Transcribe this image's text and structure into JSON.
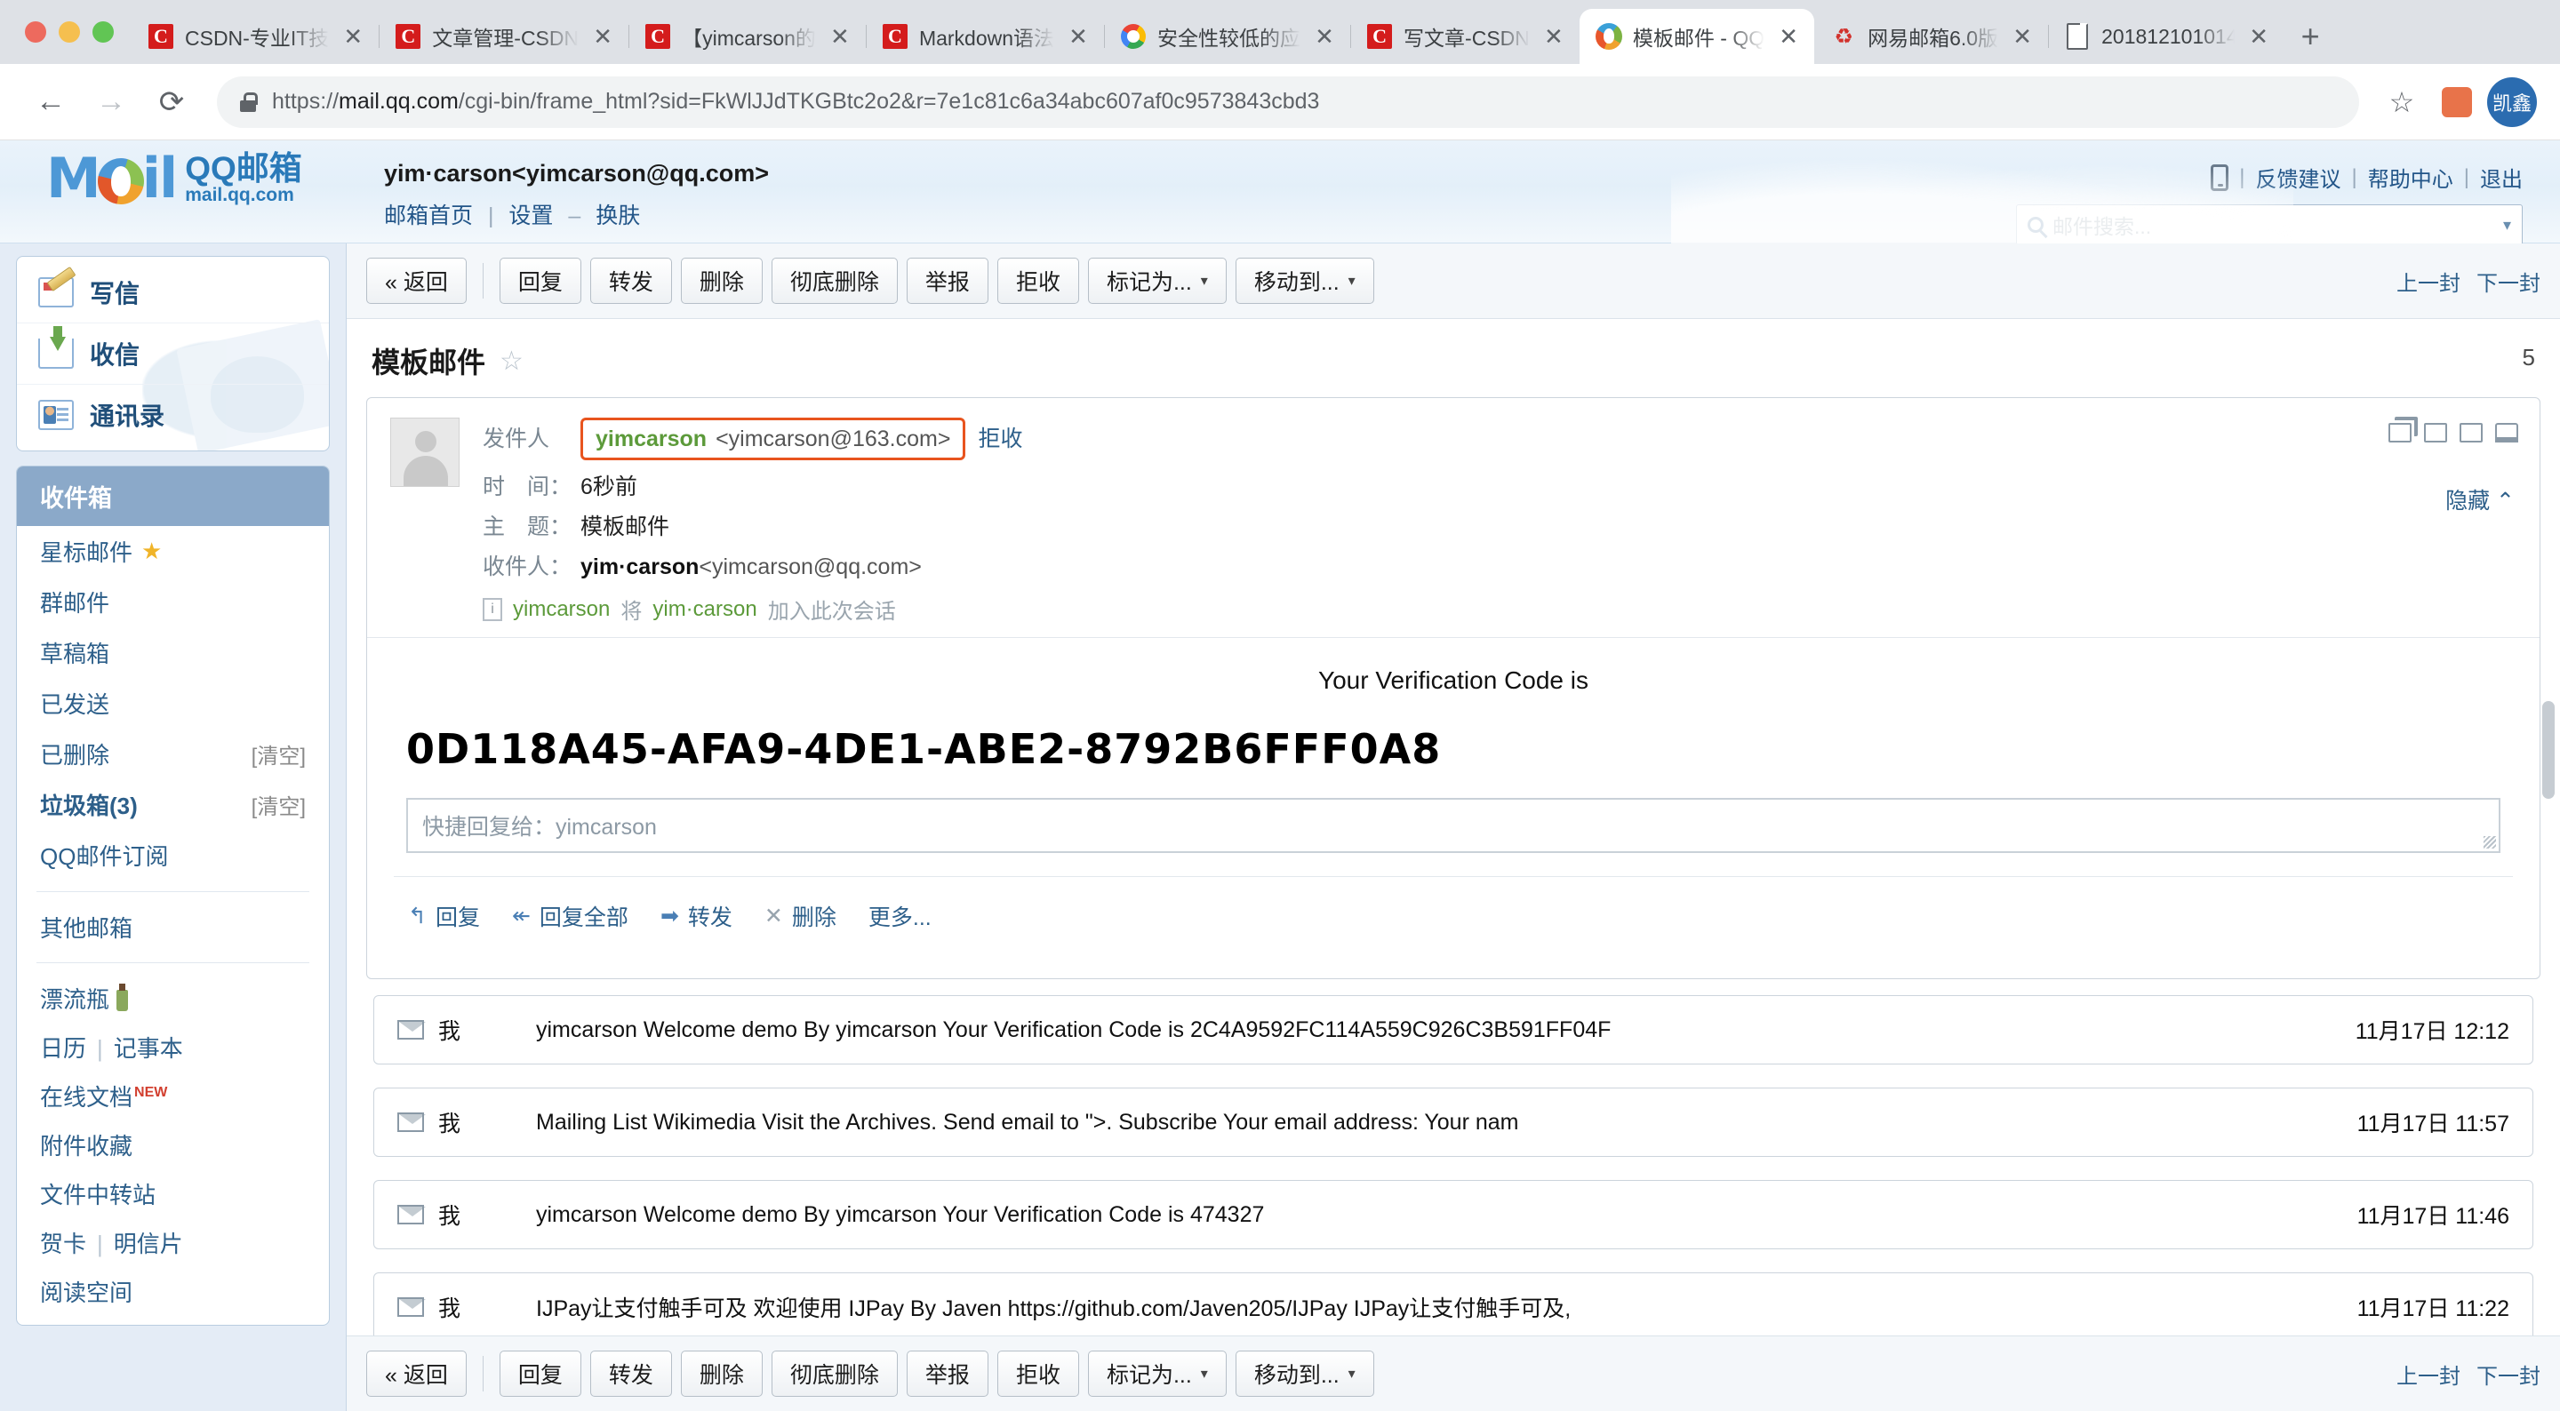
{
  "browser": {
    "tabs": [
      {
        "title": "CSDN-专业IT技",
        "favicon": "csdn-icon",
        "active": false
      },
      {
        "title": "文章管理-CSDN",
        "favicon": "csdn-icon",
        "active": false
      },
      {
        "title": "【yimcarson的",
        "favicon": "csdn-icon",
        "active": false
      },
      {
        "title": "Markdown语法",
        "favicon": "csdn-icon",
        "active": false
      },
      {
        "title": "安全性较低的应",
        "favicon": "google-icon",
        "active": false
      },
      {
        "title": "写文章-CSDN",
        "favicon": "csdn-icon",
        "active": false
      },
      {
        "title": "模板邮件 - QQ",
        "favicon": "qqmail-icon",
        "active": true
      },
      {
        "title": "网易邮箱6.0版",
        "favicon": "netease-icon",
        "active": false
      },
      {
        "title": "201812101014",
        "favicon": "document-icon",
        "active": false
      }
    ],
    "tab_close_label": "✕",
    "new_tab_label": "+",
    "back_label": "←",
    "forward_label": "→",
    "reload_label": "⟳",
    "url_scheme": "https://",
    "url_host": "mail.qq.com",
    "url_path": "/cgi-bin/frame_html?sid=FkWlJJdTKGBtc2o2&r=7e1c81c6a34abc607af0c9573843cbd3",
    "bookmark_star": "☆",
    "profile_initial": "凯鑫"
  },
  "mail_header": {
    "logo_text_main": "QQ邮箱",
    "logo_text_sub": "mail.qq.com",
    "logo_wordmark_a": "M",
    "logo_wordmark_b": "il",
    "user_account": "yim·carson<yimcarson@qq.com>",
    "links": [
      "邮箱首页",
      "设置",
      "换肤"
    ],
    "link_separator": "|",
    "link_dash": "–",
    "top_links": [
      "反馈建议",
      "帮助中心",
      "退出"
    ],
    "search_placeholder": "邮件搜索...",
    "search_caret": "▾"
  },
  "sidebar": {
    "actions": [
      {
        "label": "写信",
        "icon": "compose-icon"
      },
      {
        "label": "收信",
        "icon": "receive-icon"
      },
      {
        "label": "通讯录",
        "icon": "contacts-icon"
      }
    ],
    "selected_folder": "收件箱",
    "folders": [
      {
        "label": "星标邮件",
        "star": "★",
        "action": ""
      },
      {
        "label": "群邮件",
        "star": "",
        "action": ""
      },
      {
        "label": "草稿箱",
        "star": "",
        "action": ""
      },
      {
        "label": "已发送",
        "star": "",
        "action": ""
      },
      {
        "label": "已删除",
        "star": "",
        "action": "[清空]"
      },
      {
        "label": "垃圾箱(3)",
        "star": "",
        "action": "[清空]",
        "bold": true
      },
      {
        "label": "QQ邮件订阅",
        "star": "",
        "action": ""
      }
    ],
    "other_mailbox": "其他邮箱",
    "extras": [
      {
        "label": "漂流瓶",
        "icon": "bottle-icon"
      },
      {
        "label": "日历",
        "label2": "记事本"
      },
      {
        "label": "在线文档",
        "badge": "NEW"
      },
      {
        "label": "附件收藏"
      },
      {
        "label": "文件中转站"
      },
      {
        "label": "贺卡",
        "label2": "明信片"
      },
      {
        "label": "阅读空间"
      }
    ]
  },
  "toolbar": {
    "back_label": "« 返回",
    "buttons": [
      "回复",
      "转发",
      "删除",
      "彻底删除",
      "举报",
      "拒收"
    ],
    "dropdowns": [
      "标记为...",
      "移动到..."
    ],
    "caret": "▾",
    "prev_label": "上一封",
    "next_label": "下一封"
  },
  "message": {
    "subject": "模板邮件",
    "star_icon": "☆",
    "count_badge": "5",
    "label_from": "发件人",
    "sender_name": "yimcarson",
    "sender_address": "<yimcarson@163.com>",
    "reject_label": "拒收",
    "label_time": "时　间：",
    "time_value": "6秒前",
    "label_subject": "主　题：",
    "subject_value": "模板邮件",
    "label_to": "收件人：",
    "to_name": "yim·carson",
    "to_address": "<yimcarson@qq.com>",
    "notice_actor": "yimcarson",
    "notice_mid": "将",
    "notice_target": "yim·carson",
    "notice_tail": "加入此次会话",
    "notice_icon": "i",
    "hide_label": "隐藏",
    "hide_caret": "⌃",
    "body_title": "Your Verification Code is",
    "body_code": "0D118A45-AFA9-4DE1-ABE2-8792B6FFF0A8",
    "quick_reply_placeholder": "快捷回复给：yimcarson",
    "actions": [
      {
        "label": "回复",
        "icon": "reply-icon"
      },
      {
        "label": "回复全部",
        "icon": "reply-all-icon"
      },
      {
        "label": "转发",
        "icon": "forward-icon"
      },
      {
        "label": "删除",
        "icon": "delete-icon"
      },
      {
        "label": "更多...",
        "icon": ""
      }
    ]
  },
  "mail_list": {
    "rows": [
      {
        "sender": "我",
        "preview": "yimcarson Welcome demo By yimcarson Your Verification Code is 2C4A9592FC114A559C926C3B591FF04F",
        "time": "11月17日 12:12"
      },
      {
        "sender": "我",
        "preview": "Mailing List Wikimedia Visit the Archives. Send email to \">. Subscribe Your email address: Your nam",
        "time": "11月17日 11:57"
      },
      {
        "sender": "我",
        "preview": "yimcarson Welcome demo By yimcarson Your Verification Code is 474327",
        "time": "11月17日 11:46"
      },
      {
        "sender": "我",
        "preview": "IJPay让支付触手可及 欢迎使用 IJPay By Javen https://github.com/Javen205/IJPay IJPay让支付触手可及,",
        "time": "11月17日 11:22"
      }
    ]
  },
  "colors": {
    "accent_blue": "#2d5f8a",
    "highlight_orange": "#e8541e",
    "sender_green": "#5c9a3a",
    "selected_folder_bg": "#8ba9c9"
  }
}
